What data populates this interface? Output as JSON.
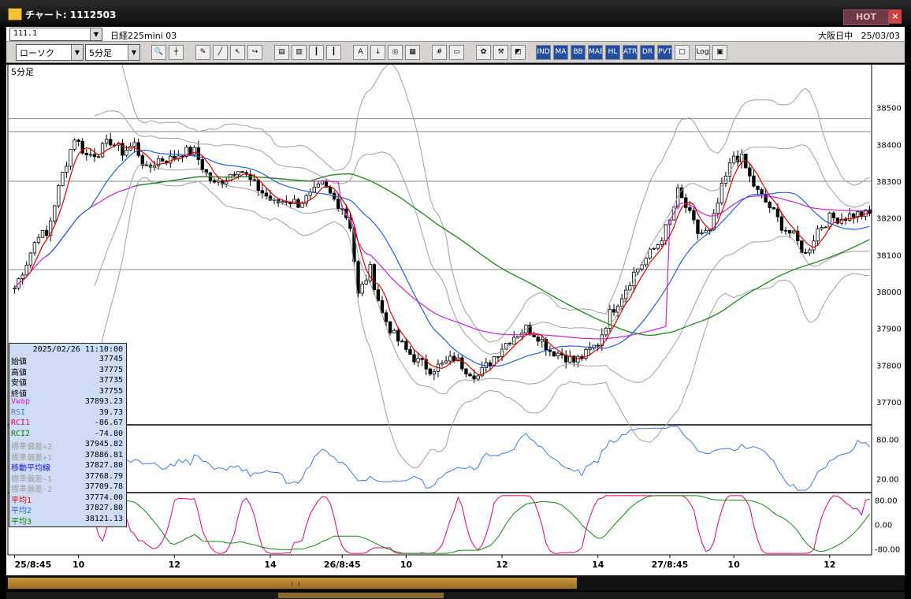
{
  "window": {
    "title": "チャート: 1112503",
    "hot_label": "HOT",
    "close_label": "×"
  },
  "symbol_bar": {
    "code": "111.1",
    "name": "日経225mini 03",
    "exchange": "大阪日中",
    "date": "25/03/03"
  },
  "toolbar": {
    "chart_type": "ローソク",
    "interval": "5分足",
    "buttons": [
      "zoom-icon",
      "crosshair-icon",
      "pencil-icon",
      "line-tool-icon",
      "cursor-icon",
      "redo-icon",
      "print-icon",
      "trash-icon",
      "bar-chart-icon",
      "bar-chart-2-icon",
      "all-icon",
      "down-arrow-icon",
      "search-chart-icon",
      "chart-config-icon",
      "mesh-icon",
      "memo-icon",
      "gear-icon",
      "wrench-icon",
      "palette-icon"
    ],
    "indicator_buttons": [
      "IND",
      "MA",
      "BB",
      "MAE",
      "HL",
      "ATR",
      "DR",
      "PVT"
    ],
    "extra_buttons": [
      "window-icon",
      "Log",
      "pin-icon"
    ]
  },
  "chart_data": {
    "type": "candlestick",
    "period_label": "5分足",
    "price_axis": [
      "38500",
      "38400",
      "38300",
      "38200",
      "38100",
      "38000",
      "37900",
      "37800",
      "37700"
    ],
    "price_range": [
      37640,
      38570
    ],
    "hlines": [
      38470,
      38435,
      38300,
      38060
    ],
    "time_labels": [
      "25/8:45",
      "10",
      "12",
      "14",
      "26/8:45",
      "10",
      "12",
      "14",
      "27/8:45",
      "10",
      "12"
    ],
    "time_label_bars": [
      0,
      16,
      40,
      64,
      82,
      98,
      122,
      146,
      164,
      180,
      204
    ],
    "ohlc_anchors": [
      [
        0,
        38010
      ],
      [
        3,
        38080
      ],
      [
        6,
        38160
      ],
      [
        8,
        38150
      ],
      [
        10,
        38240
      ],
      [
        12,
        38320
      ],
      [
        15,
        38420
      ],
      [
        18,
        38370
      ],
      [
        21,
        38380
      ],
      [
        24,
        38410
      ],
      [
        27,
        38380
      ],
      [
        30,
        38400
      ],
      [
        33,
        38330
      ],
      [
        36,
        38360
      ],
      [
        39,
        38360
      ],
      [
        42,
        38380
      ],
      [
        45,
        38380
      ],
      [
        48,
        38320
      ],
      [
        50,
        38290
      ],
      [
        53,
        38310
      ],
      [
        56,
        38340
      ],
      [
        59,
        38300
      ],
      [
        62,
        38270
      ],
      [
        65,
        38240
      ],
      [
        68,
        38250
      ],
      [
        71,
        38240
      ],
      [
        74,
        38260
      ],
      [
        77,
        38290
      ],
      [
        80,
        38250
      ],
      [
        82,
        38230
      ],
      [
        84,
        38180
      ],
      [
        86,
        37990
      ],
      [
        89,
        38060
      ],
      [
        92,
        37940
      ],
      [
        95,
        37880
      ],
      [
        98,
        37840
      ],
      [
        101,
        37810
      ],
      [
        104,
        37790
      ],
      [
        107,
        37800
      ],
      [
        110,
        37820
      ],
      [
        113,
        37790
      ],
      [
        116,
        37770
      ],
      [
        119,
        37810
      ],
      [
        122,
        37850
      ],
      [
        125,
        37880
      ],
      [
        128,
        37900
      ],
      [
        131,
        37880
      ],
      [
        134,
        37840
      ],
      [
        137,
        37830
      ],
      [
        140,
        37810
      ],
      [
        143,
        37830
      ],
      [
        146,
        37860
      ],
      [
        149,
        37940
      ],
      [
        152,
        37990
      ],
      [
        155,
        38050
      ],
      [
        158,
        38090
      ],
      [
        161,
        38130
      ],
      [
        164,
        38190
      ],
      [
        166,
        38270
      ],
      [
        168,
        38230
      ],
      [
        171,
        38160
      ],
      [
        174,
        38160
      ],
      [
        177,
        38280
      ],
      [
        180,
        38370
      ],
      [
        182,
        38360
      ],
      [
        184,
        38310
      ],
      [
        186,
        38270
      ],
      [
        189,
        38230
      ],
      [
        192,
        38180
      ],
      [
        195,
        38150
      ],
      [
        198,
        38100
      ],
      [
        201,
        38170
      ],
      [
        204,
        38200
      ],
      [
        207,
        38200
      ],
      [
        210,
        38210
      ],
      [
        214,
        38210
      ]
    ],
    "sub1": {
      "name": "RSI",
      "levels": [
        "80.00",
        "20.00"
      ],
      "range": [
        0,
        100
      ]
    },
    "sub2": {
      "name": "RCI",
      "levels": [
        "80.00",
        "0.00",
        "-80.00"
      ],
      "range": [
        -100,
        100
      ]
    }
  },
  "info_panel": {
    "datetime": "2025/02/26 11:10:00",
    "rows": [
      {
        "label": "始値",
        "value": "37745",
        "color": "#000000"
      },
      {
        "label": "高値",
        "value": "37775",
        "color": "#000000"
      },
      {
        "label": "安値",
        "value": "37735",
        "color": "#000000"
      },
      {
        "label": "終値",
        "value": "37755",
        "color": "#000000"
      },
      {
        "label": "Vwap",
        "value": "37893.23",
        "color": "#d020d0"
      },
      {
        "label": "RSI",
        "value": "39.73",
        "color": "#3b7be0"
      },
      {
        "label": "RCI1",
        "value": "-86.67",
        "color": "#e0007a"
      },
      {
        "label": "RCI2",
        "value": "-74.80",
        "color": "#008a00"
      },
      {
        "label": "標準偏差+2",
        "value": "37945.82",
        "color": "#a0a0a0"
      },
      {
        "label": "標準偏差+1",
        "value": "37886.81",
        "color": "#a0a0a0"
      },
      {
        "label": "移動平均線",
        "value": "37827.80",
        "color": "#1a1ad8"
      },
      {
        "label": "標準偏差-1",
        "value": "37768.79",
        "color": "#a0a0a0"
      },
      {
        "label": "標準偏差-2",
        "value": "37709.78",
        "color": "#a0a0a0"
      },
      {
        "label": "平均1",
        "value": "37774.00",
        "color": "#e00000"
      },
      {
        "label": "平均2",
        "value": "37827.80",
        "color": "#1a6ad8"
      },
      {
        "label": "平均3",
        "value": "38121.13",
        "color": "#008a00"
      }
    ]
  },
  "colors": {
    "vwap": "#d020d0",
    "ma1": "#e00000",
    "ma2": "#2060e0",
    "ma3": "#1a8a1a",
    "bands": "#a0a0a0",
    "rsi": "#3b7be0",
    "rci1": "#e0007a",
    "rci2": "#108a10",
    "scroll": "#c8973a"
  }
}
